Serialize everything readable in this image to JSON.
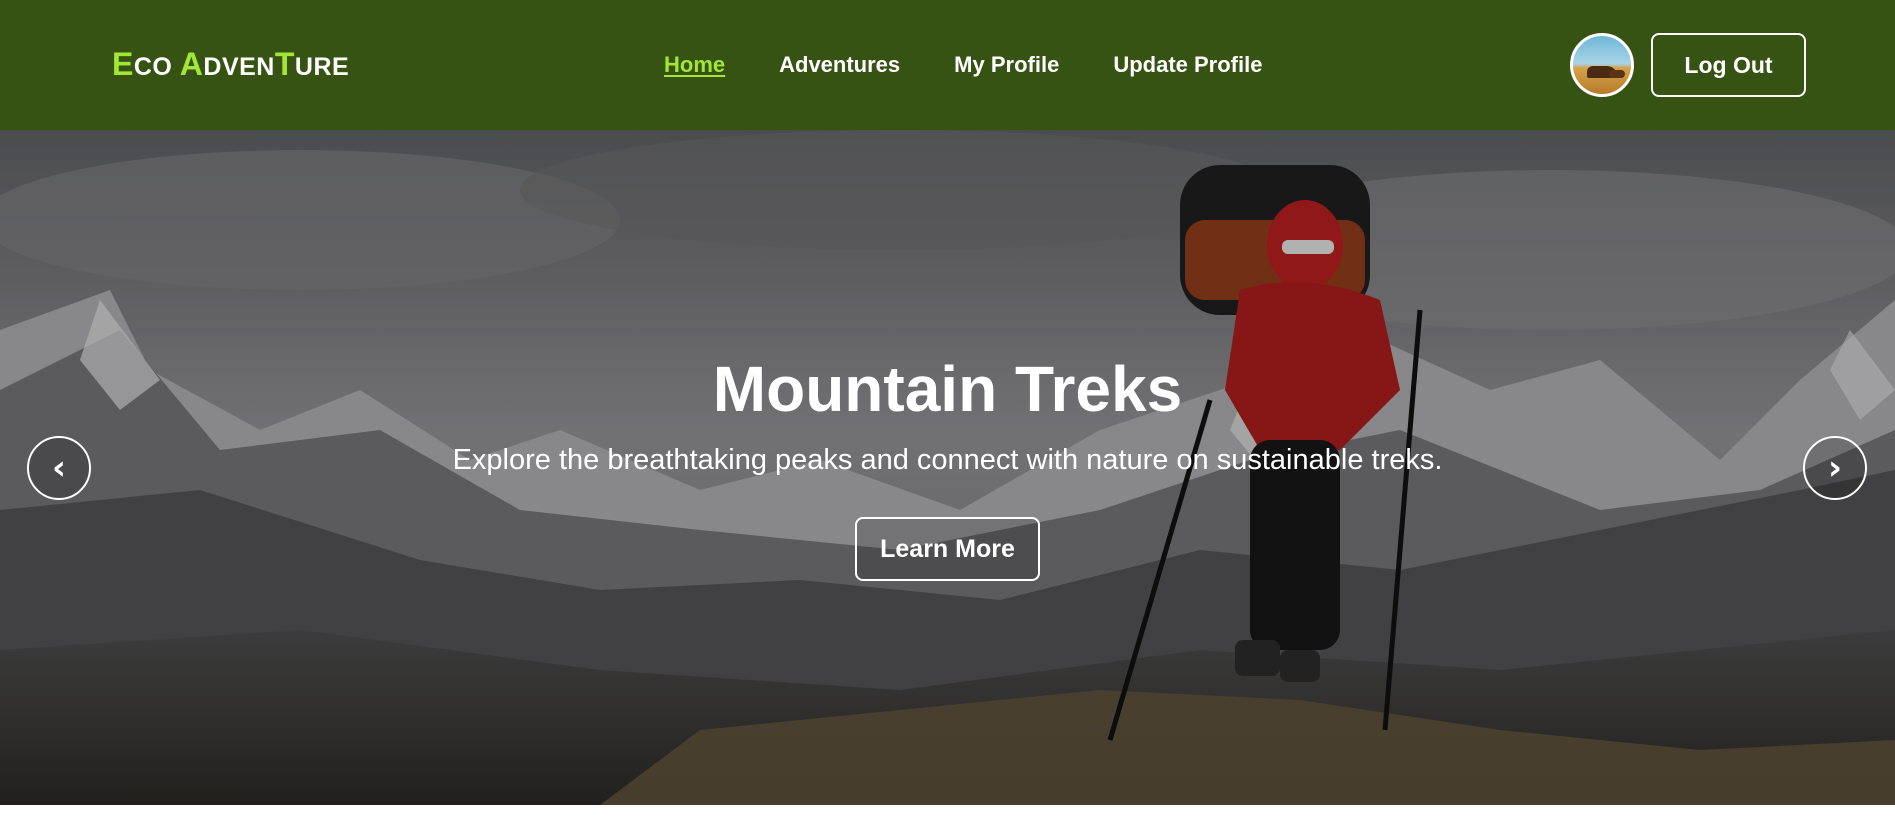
{
  "brand": {
    "parts": [
      {
        "text": "E",
        "style": "big"
      },
      {
        "text": "CO ",
        "style": "small"
      },
      {
        "text": "A",
        "style": "big"
      },
      {
        "text": "DVEN",
        "style": "small"
      },
      {
        "text": "T",
        "style": "big"
      },
      {
        "text": "URE",
        "style": "small"
      }
    ],
    "accent_color": "#a3e635"
  },
  "nav": {
    "items": [
      {
        "label": "Home",
        "active": true
      },
      {
        "label": "Adventures",
        "active": false
      },
      {
        "label": "My Profile",
        "active": false
      },
      {
        "label": "Update Profile",
        "active": false
      }
    ],
    "background_color": "#365314"
  },
  "user": {
    "avatar_icon": "user-avatar-desert-camels",
    "logout_label": "Log Out"
  },
  "hero": {
    "title": "Mountain Treks",
    "subtitle": "Explore the breathtaking peaks and connect with nature on sustainable treks.",
    "cta_label": "Learn More",
    "prev_glyph": "‹",
    "next_glyph": "›"
  }
}
